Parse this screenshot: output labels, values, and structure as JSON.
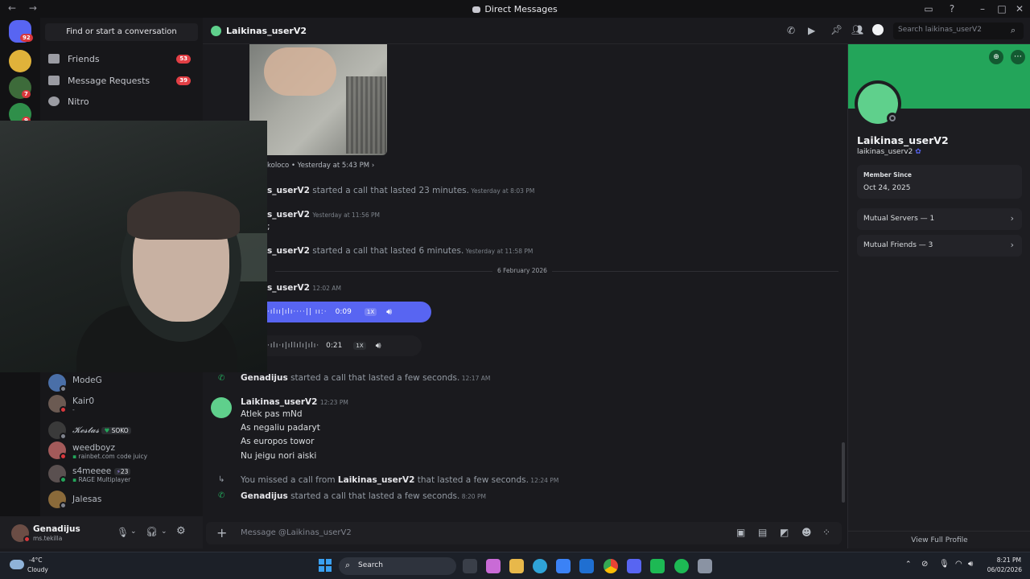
{
  "titlebar": {
    "title": "Direct Messages"
  },
  "rail": {
    "home_badge": "92",
    "servers": [
      {
        "badge": ""
      },
      {
        "badge": "7"
      },
      {
        "badge": "9"
      }
    ]
  },
  "sidebar": {
    "search_label": "Find or start a conversation",
    "nav": [
      {
        "label": "Friends",
        "count": "53"
      },
      {
        "label": "Message Requests",
        "count": "39"
      },
      {
        "label": "Nitro",
        "count": ""
      }
    ],
    "dms": [
      {
        "name": "ModeG",
        "sub": "",
        "avatar": "#4a6fa8",
        "status": "#80848e"
      },
      {
        "name": "Kair0",
        "sub": "-",
        "avatar": "#6b5a52",
        "status": "#da373c"
      },
      {
        "name": "𝓚𝓮𝓼𝓽𝓪𝓼",
        "tag": "SOKO",
        "sub": "",
        "avatar": "#3a3a3a",
        "status": "#80848e"
      },
      {
        "name": "weedboyz",
        "sub": "rainbet.com code juicy",
        "avatar": "#a35a5a",
        "status": "#da373c"
      },
      {
        "name": "s4meeee",
        "tag": "23",
        "sub": "RAGE Multiplayer",
        "avatar": "#5a5050",
        "status": "#23a55a"
      },
      {
        "name": "Jalesas",
        "sub": "",
        "avatar": "#8a6a3a",
        "status": "#80848e"
      }
    ]
  },
  "user_panel": {
    "name": "Genadijus",
    "handle": "ms.tekilla"
  },
  "chat": {
    "header_name": "Laikinas_userV2",
    "search_placeholder": "Search laikinas_userV2",
    "image_meta": "koloco • Yesterday at 5:43 PM ›",
    "events": [
      {
        "name": "s_userV2",
        "text": " started a call that lasted 23 minutes.",
        "time": " Yesterday at 8:03 PM"
      },
      {
        "name": "s_userV2",
        "text": "",
        "time": "Yesterday at 11:56 PM"
      },
      {
        "name": "s_userV2",
        "text": " started a call that lasted 6 minutes.",
        "time": " Yesterday at 11:58 PM"
      }
    ],
    "date_divider": "6 February 2026",
    "vm_author": "s_userV2",
    "vm_author_time": "12:02 AM",
    "voice1": {
      "duration": "0:09",
      "speed": "1X"
    },
    "voice2": {
      "duration": "0:21",
      "speed": "1X"
    },
    "call_genadijus1": {
      "name": "Genadijus",
      "text": " started a call that lasted a few seconds.",
      "time": " 12:17 AM"
    },
    "message": {
      "author": "Laikinas_userV2",
      "time": "12:23 PM",
      "lines": [
        "Atlek pas mNd",
        "As negaliu padaryt",
        "As europos towor",
        "Nu jeigu nori aiski"
      ]
    },
    "missed": {
      "pre": "You missed a call from ",
      "name": "Laikinas_userV2",
      "post": " that lasted a few seconds.",
      "time": " 12:24 PM"
    },
    "call_genadijus2": {
      "name": "Genadijus",
      "text": " started a call that lasted a few seconds.",
      "time": " 8:20 PM"
    },
    "composer_placeholder": "Message @Laikinas_userV2"
  },
  "profile": {
    "banner_color": "#23a55a",
    "display_name": "Laikinas_userV2",
    "username": "laikinas_userv2",
    "member_since_label": "Member Since",
    "member_since": "Oct 24, 2025",
    "mutual_servers": "Mutual Servers — 1",
    "mutual_friends": "Mutual Friends — 3",
    "view_full": "View Full Profile"
  },
  "taskbar": {
    "weather_temp": "-4°C",
    "weather_desc": "Cloudy",
    "search": "Search",
    "time": "8:21 PM",
    "date": "06/02/2026"
  },
  "colors": {
    "accent": "#5865f2",
    "online": "#23a55a",
    "danger": "#da373c"
  }
}
